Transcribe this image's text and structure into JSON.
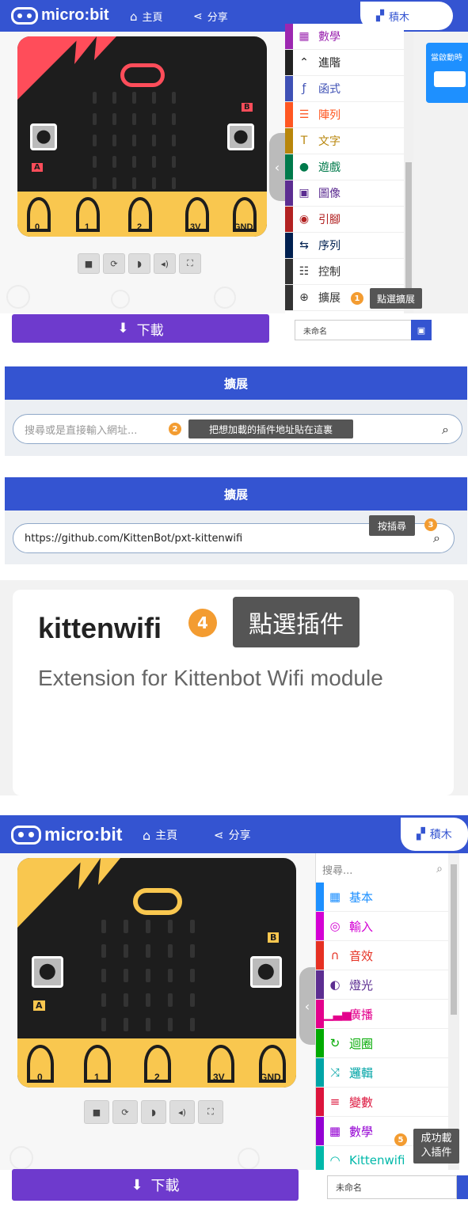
{
  "brand": "micro:bit",
  "nav": {
    "home": "主頁",
    "share": "分享",
    "blocks": "積木"
  },
  "section1": {
    "toolbox": [
      {
        "label": "數學",
        "icon": "calculator-icon",
        "color": "#9c27b0"
      },
      {
        "label": "進階",
        "icon": "chevron-up-icon",
        "color": "#222222"
      },
      {
        "label": "函式",
        "icon": "function-icon",
        "color": "#3f51b5"
      },
      {
        "label": "陣列",
        "icon": "list-icon",
        "color": "#ff5722"
      },
      {
        "label": "文字",
        "icon": "text-icon",
        "color": "#b8860b"
      },
      {
        "label": "遊戲",
        "icon": "gamepad-icon",
        "color": "#007a4b"
      },
      {
        "label": "圖像",
        "icon": "image-icon",
        "color": "#5c2d91"
      },
      {
        "label": "引腳",
        "icon": "pin-icon",
        "color": "#b22222"
      },
      {
        "label": "序列",
        "icon": "usb-icon",
        "color": "#002050"
      },
      {
        "label": "控制",
        "icon": "control-icon",
        "color": "#333333"
      },
      {
        "label": "擴展",
        "icon": "plus-circle-icon",
        "color": "#333333"
      }
    ],
    "workspace_block": "當啟動時",
    "callout_num": "1",
    "callout_text": "點選擴展",
    "download": "下載",
    "filename": "未命名"
  },
  "panel2": {
    "title": "擴展",
    "placeholder": "搜尋或是直接輸入網址...",
    "callout_num": "2",
    "callout_text": "把想加載的插件地址貼在這裏"
  },
  "panel3": {
    "title": "擴展",
    "url": "https://github.com/KittenBot/pxt-kittenwifi",
    "callout_num": "3",
    "callout_text": "按插尋"
  },
  "card": {
    "title": "kittenwifi",
    "desc": "Extension for Kittenbot Wifi module",
    "callout_num": "4",
    "callout_text": "點選插件"
  },
  "section5": {
    "search_placeholder": "搜尋...",
    "toolbox": [
      {
        "label": "基本",
        "icon": "grid-icon",
        "color": "#1e90ff"
      },
      {
        "label": "輸入",
        "icon": "target-icon",
        "color": "#d400d4"
      },
      {
        "label": "音效",
        "icon": "headphones-icon",
        "color": "#e63022"
      },
      {
        "label": "燈光",
        "icon": "toggle-icon",
        "color": "#5c2d91"
      },
      {
        "label": "廣播",
        "icon": "signal-bars-icon",
        "color": "#e3008c"
      },
      {
        "label": "迴圈",
        "icon": "refresh-icon",
        "color": "#00aa00"
      },
      {
        "label": "邏輯",
        "icon": "shuffle-icon",
        "color": "#00a4a6"
      },
      {
        "label": "變數",
        "icon": "lines-icon",
        "color": "#dc143c"
      },
      {
        "label": "數學",
        "icon": "calculator-icon",
        "color": "#9400d3"
      },
      {
        "label": "Kittenwifi",
        "icon": "wifi-icon",
        "color": "#00b8a9"
      }
    ],
    "callout_num": "5",
    "callout_text1": "成功載",
    "callout_text2": "入插件",
    "download": "下載",
    "filename": "未命名"
  },
  "pins": [
    "0",
    "1",
    "2",
    "3V",
    "GND"
  ],
  "buttons": {
    "a": "A",
    "b": "B"
  },
  "colors": {
    "brand": "#3454d1",
    "download": "#6e3acd",
    "callout": "#f39c31",
    "board_top1": "#ff4d5a",
    "board_top2": "#f9c74f"
  }
}
